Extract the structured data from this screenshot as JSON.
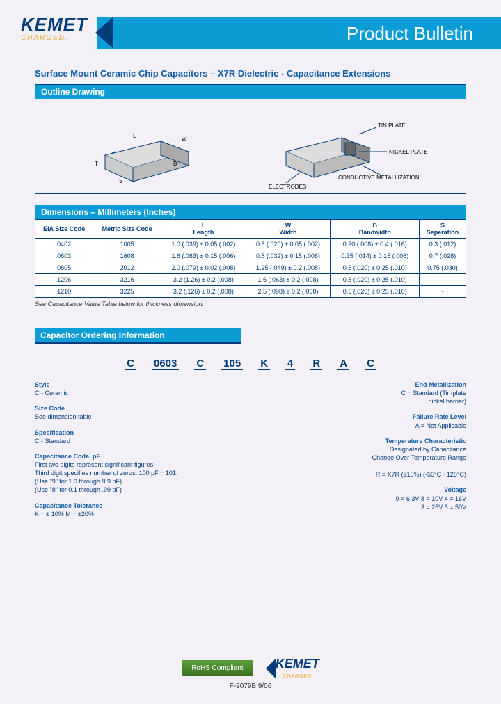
{
  "header": {
    "logo": "KEMET",
    "tagline": "CHARGED.",
    "banner": "Product Bulletin"
  },
  "title": "Surface Mount Ceramic Chip Capacitors – X7R Dielectric - Capacitance Extensions",
  "outline": {
    "header": "Outline Drawing",
    "labels": {
      "L": "L",
      "W": "W",
      "T": "T",
      "B": "B",
      "S": "S",
      "tin": "TIN PLATE",
      "nickel": "NICKEL PLATE",
      "elec": "ELECTRODES",
      "cond": "CONDUCTIVE METALLIZATION"
    }
  },
  "dimensions": {
    "header": "Dimensions – Millimeters (Inches)",
    "columns": [
      "EIA Size Code",
      "Metric Size Code",
      "L\nLength",
      "W\nWidth",
      "B\nBandwidth",
      "S\nSeperation"
    ],
    "rows": [
      [
        "0402",
        "1005",
        "1.0 (.039) ± 0.05 (.002)",
        "0.5 (.020) ± 0.05 (.002)",
        "0.20 (.008) ± 0.4 (.016)",
        "0.3 (.012)"
      ],
      [
        "0603",
        "1608",
        "1.6 (.063) ± 0.15 (.006)",
        "0.8 (.032) ± 0.15 (.006)",
        "0.35 (.014) ± 0.15 (.006)",
        "0.7 (.028)"
      ],
      [
        "0805",
        "2012",
        "2.0 (.079) ± 0.02 (.008)",
        "1.25 (.049) ± 0.2 (.008)",
        "0.5 (.020) ± 0.25 (.010)",
        "0.75 (.030)"
      ],
      [
        "1206",
        "3216",
        "3.2 (1.26) ± 0.2 (.008)",
        "1.6 (.063) ± 0.2 (.008)",
        "0.5 (.020) ± 0.25 (.010)",
        "-"
      ],
      [
        "1210",
        "3225",
        "3.2 (.126) ± 0.2 (.008)",
        "2.5 (.098) ± 0.2 (.008)",
        "0.5 (.020) ± 0.25 (.010)",
        "-"
      ]
    ],
    "note": "See Capacitance Value Table below for thickness dimension."
  },
  "ordering": {
    "header": "Capacitor Ordering Information",
    "parts": [
      "C",
      "0603",
      "C",
      "105",
      "K",
      "4",
      "R",
      "A",
      "C"
    ],
    "left": [
      {
        "t": "Style",
        "d": "C - Ceramic"
      },
      {
        "t": "Size Code",
        "d": "See dimension table"
      },
      {
        "t": "Specification",
        "d": "C - Standard"
      },
      {
        "t": "Capacitance Code, pF",
        "d": "First two digits represent significant figures.\nThird digit specifies number of zeros. 100 pF = 101.\n(Use \"9\" for 1.0 through 9.9 pF)\n(Use \"8\" for 0.1 through .99 pF)"
      },
      {
        "t": "Capacitance Tolerance",
        "d": "K = ± 10%     M = ±20%"
      }
    ],
    "right": [
      {
        "t": "End Metallization",
        "d": "C = Standard (Tin-plate\nnickel barrier)"
      },
      {
        "t": "Failure Rate Level",
        "d": "A = Not Applicable"
      },
      {
        "t": "Temperature Characteristic",
        "d": "Designated by Capacitance\nChange Over Temperature Range\n\nR = X7R (±15%) (-55°C +125°C)"
      },
      {
        "t": "Voltage",
        "d": "9 = 6.3V    8 = 10V    4 = 16V\n3 = 25V    5 = 50V"
      }
    ]
  },
  "footer": {
    "rohs": "RoHS Compliant",
    "logo": "KEMET",
    "tagline": "CHARGED",
    "doc": "F-9079B 9/06"
  }
}
